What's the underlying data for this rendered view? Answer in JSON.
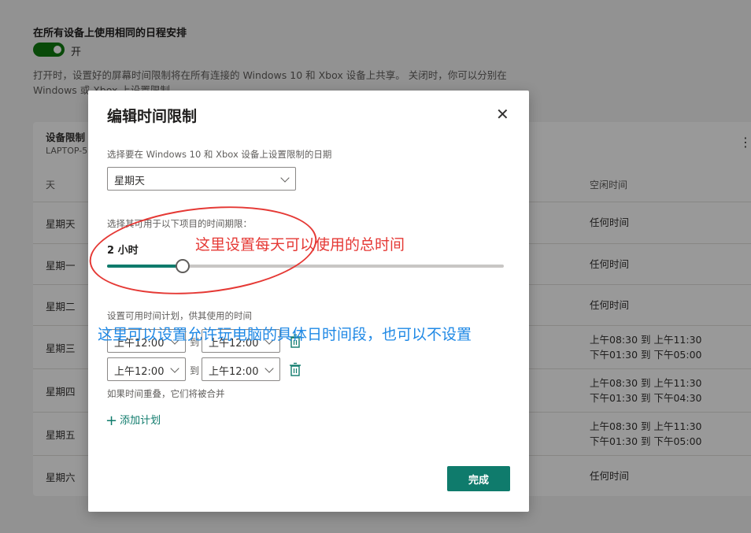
{
  "background": {
    "setting_title": "在所有设备上使用相同的日程安排",
    "toggle_label": "开",
    "description": "打开时，设置好的屏幕时间限制将在所有连接的 Windows 10 和 Xbox 设备上共享。 关闭时，你可以分别在 Windows 或 Xbox 上设置限制",
    "card": {
      "title": "设备限制",
      "subtitle": "LAPTOP-5",
      "more_icon": "more-vertical-icon",
      "col_day": "天",
      "col_idle": "空闲时间",
      "rows": [
        {
          "day": "星期天",
          "idle": [
            "任何时间"
          ]
        },
        {
          "day": "星期一",
          "idle": [
            "任何时间"
          ]
        },
        {
          "day": "星期二",
          "idle": [
            "任何时间"
          ]
        },
        {
          "day": "星期三",
          "idle": [
            "上午08:30 到 上午11:30",
            "下午01:30 到 下午05:00"
          ]
        },
        {
          "day": "星期四",
          "idle": [
            "上午08:30 到 上午11:30",
            "下午01:30 到 下午04:30"
          ]
        },
        {
          "day": "星期五",
          "idle": [
            "上午08:30 到 上午11:30",
            "下午01:30 到 下午05:00"
          ]
        },
        {
          "day": "星期六",
          "idle": [
            "任何时间"
          ]
        }
      ]
    }
  },
  "modal": {
    "title": "编辑时间限制",
    "close_icon": "close-icon",
    "day_label": "选择要在 Windows 10 和 Xbox 设备上设置限制的日期",
    "day_value": "星期天",
    "limit_label": "选择其可用于以下项目的时间期限：",
    "limit_value": "2 小时",
    "slider_fraction": 0.19,
    "schedule_label": "设置可用时间计划，供其使用的时间",
    "schedules": [
      {
        "from": "上午12:00",
        "to_word": "到",
        "to": "上午12:00"
      },
      {
        "from": "上午12:00",
        "to_word": "到",
        "to": "上午12:00"
      }
    ],
    "overlap_note": "如果时间重叠，它们将被合并",
    "add_label": "添加计划",
    "done_label": "完成",
    "accent": "#0f7b6c"
  },
  "annotations": {
    "red_note": "这里设置每天可以使用的总时间",
    "blue_note": "这里可以设置允许玩电脑的具体日时间段，也可以不设置"
  }
}
